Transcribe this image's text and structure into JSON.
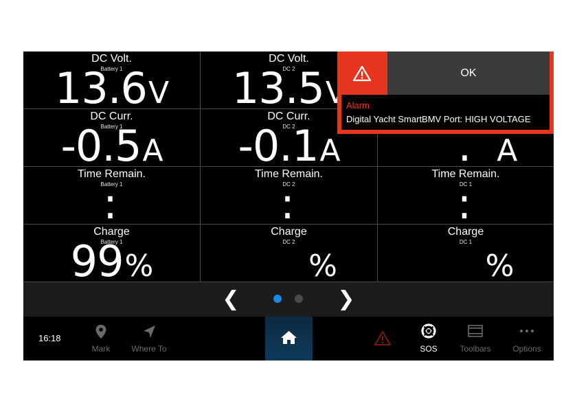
{
  "cells": [
    {
      "title": "DC Volt.",
      "source": "Battery 1",
      "number": "13.6",
      "unit": "V"
    },
    {
      "title": "DC Volt.",
      "source": "DC 2",
      "number": "13.5",
      "unit": "V"
    },
    {
      "title": "",
      "source": "",
      "number": "",
      "unit": ""
    },
    {
      "title": "DC Curr.",
      "source": "Battery 1",
      "number": "-0.5",
      "unit": "A"
    },
    {
      "title": "DC Curr.",
      "source": "DC 2",
      "number": "-0.1",
      "unit": "A"
    },
    {
      "title": "",
      "source": "",
      "number": "__._",
      "unit": "A"
    },
    {
      "title": "Time Remain.",
      "source": "Battery 1",
      "number": "__:__",
      "unit": ""
    },
    {
      "title": "Time Remain.",
      "source": "DC 2",
      "number": "__:__",
      "unit": ""
    },
    {
      "title": "Time Remain.",
      "source": "DC 1",
      "number": "__:__",
      "unit": ""
    },
    {
      "title": "Charge",
      "source": "Battery 1",
      "number": "99",
      "unit": "%"
    },
    {
      "title": "Charge",
      "source": "DC 2",
      "number": "___",
      "unit": "%"
    },
    {
      "title": "Charge",
      "source": "DC 1",
      "number": "___",
      "unit": "%"
    }
  ],
  "pager": {
    "prev_glyph": "❮",
    "next_glyph": "❯",
    "pages": 2,
    "current_page": 1,
    "active_color": "#1e88e5",
    "inactive_color": "#4a4a4a"
  },
  "toolbar": {
    "time": "16:18",
    "mark_label": "Mark",
    "where_to_label": "Where To",
    "sos_label": "SOS",
    "toolbars_label": "Toolbars",
    "options_label": "Options",
    "home_icon": "home-icon",
    "alarm_icon": "warning-icon"
  },
  "alarm": {
    "ok_label": "OK",
    "heading": "Alarm",
    "message": "Digital Yacht SmartBMV Port: HIGH VOLTAGE",
    "color": "#e8351f"
  }
}
